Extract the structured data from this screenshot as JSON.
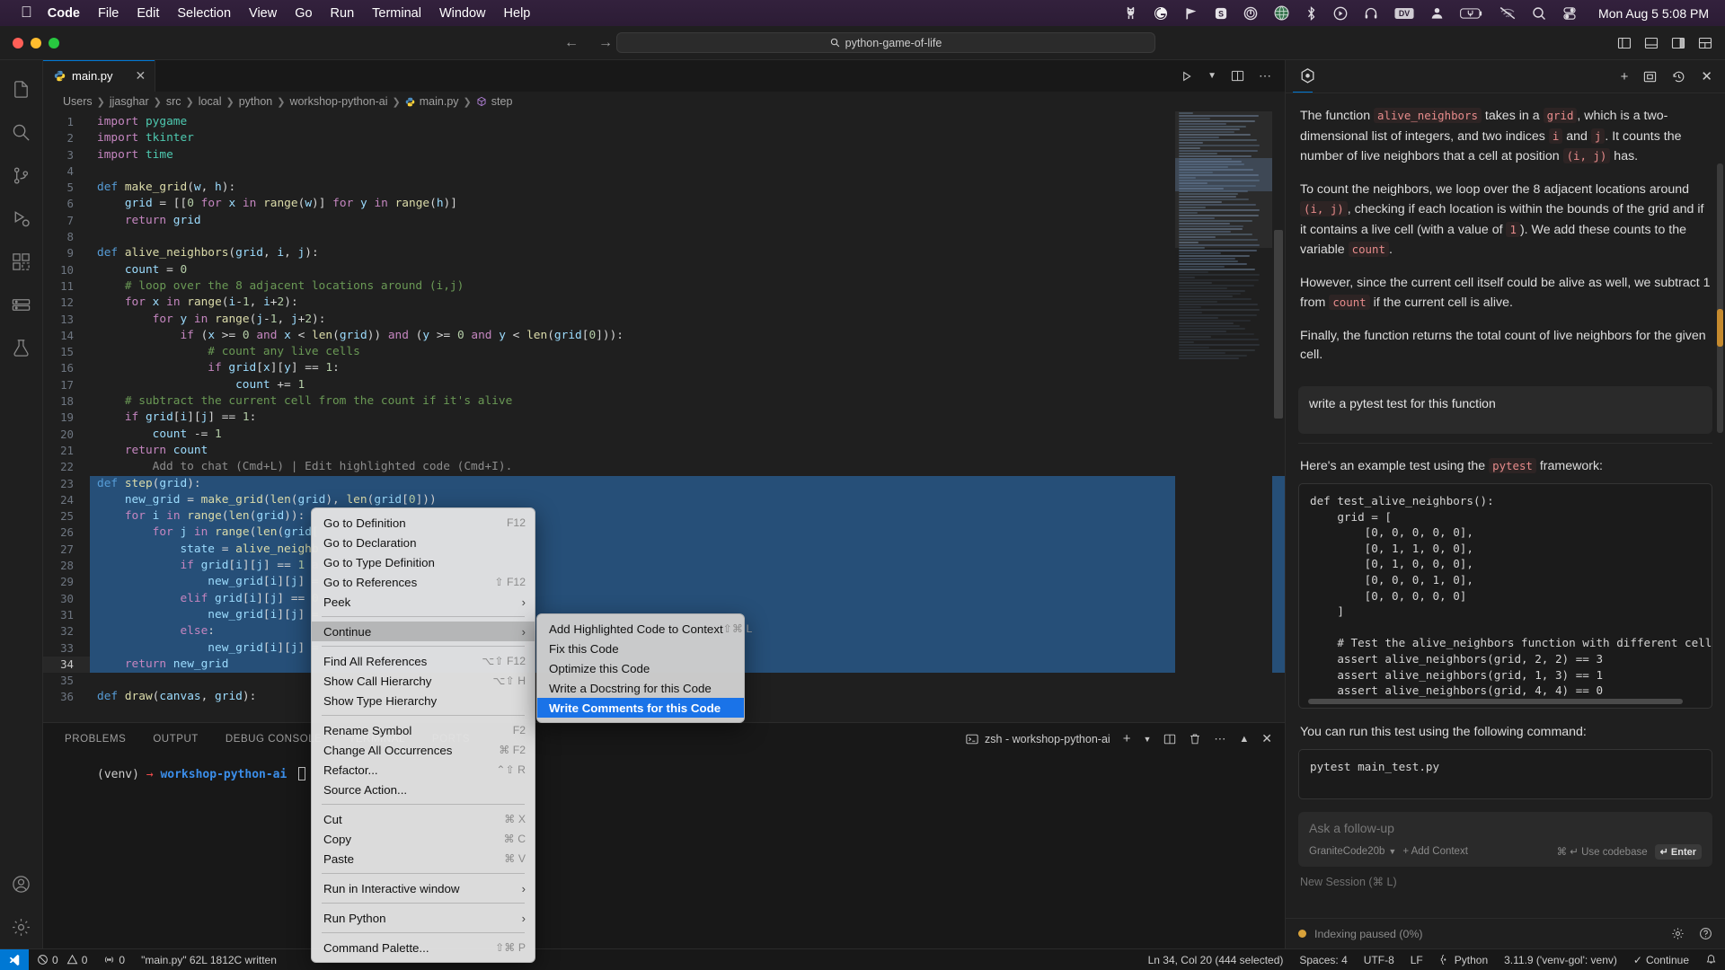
{
  "macos_menubar": {
    "apple_icon": "apple-icon",
    "items": [
      "Code",
      "File",
      "Edit",
      "Selection",
      "View",
      "Go",
      "Run",
      "Terminal",
      "Window",
      "Help"
    ],
    "tray_icons": [
      "llama-icon",
      "grammarly-icon",
      "flag-icon",
      "s-badge-icon",
      "onepassword-icon",
      "globe-icon",
      "bluetooth-icon",
      "play-circle-icon",
      "headphones-icon",
      "dv-icon",
      "person-icon",
      "battery-icon",
      "wifi-off-icon",
      "search-icon",
      "control-center-icon"
    ],
    "clock": "Mon Aug 5  5:08 PM"
  },
  "titlebar": {
    "search_value": "python-game-of-life",
    "search_icon": "search-icon",
    "back_icon": "arrow-left-icon",
    "forward_icon": "arrow-right-icon",
    "layout_icons": [
      "toggle-primary-sidebar-icon",
      "toggle-panel-icon",
      "toggle-secondary-sidebar-icon",
      "customize-layout-icon"
    ]
  },
  "activitybar": {
    "items": [
      {
        "name": "explorer",
        "icon": "files-icon"
      },
      {
        "name": "search",
        "icon": "search-icon"
      },
      {
        "name": "source-control",
        "icon": "source-control-icon"
      },
      {
        "name": "run-and-debug",
        "icon": "debug-icon"
      },
      {
        "name": "extensions",
        "icon": "extensions-icon"
      },
      {
        "name": "remote-explorer",
        "icon": "remote-explorer-icon"
      },
      {
        "name": "testing",
        "icon": "beaker-icon"
      }
    ],
    "bottom": [
      {
        "name": "accounts",
        "icon": "account-icon"
      },
      {
        "name": "settings",
        "icon": "gear-icon"
      }
    ]
  },
  "editor": {
    "tab": {
      "label": "main.py",
      "icon": "python-file-icon",
      "close_icon": "close-icon"
    },
    "tab_actions": [
      "run-python-icon",
      "chevron-down-icon",
      "split-editor-icon",
      "more-actions-icon"
    ],
    "breadcrumb": [
      "Users",
      "jjasghar",
      "src",
      "local",
      "python",
      "workshop-python-ai",
      "main.py",
      "step"
    ],
    "lines": [
      {
        "n": 1,
        "html": "<span class='k'>import</span> <span class='bu'>pygame</span>"
      },
      {
        "n": 2,
        "html": "<span class='k'>import</span> <span class='bu'>tkinter</span>"
      },
      {
        "n": 3,
        "html": "<span class='k'>import</span> <span class='bu'>time</span>"
      },
      {
        "n": 4,
        "html": ""
      },
      {
        "n": 5,
        "html": "<span class='kb'>def</span> <span class='fn'>make_grid</span><span class='pl'>(</span><span class='va'>w</span><span class='pl'>, </span><span class='va'>h</span><span class='pl'>):</span>"
      },
      {
        "n": 6,
        "html": "    <span class='va'>grid</span> <span class='pl'>= [[</span><span class='nu'>0</span> <span class='k'>for</span> <span class='va'>x</span> <span class='k'>in</span> <span class='fn'>range</span><span class='pl'>(</span><span class='va'>w</span><span class='pl'>)] </span><span class='k'>for</span> <span class='va'>y</span> <span class='k'>in</span> <span class='fn'>range</span><span class='pl'>(</span><span class='va'>h</span><span class='pl'>)]</span>"
      },
      {
        "n": 7,
        "html": "    <span class='k'>return</span> <span class='va'>grid</span>"
      },
      {
        "n": 8,
        "html": ""
      },
      {
        "n": 9,
        "html": "<span class='kb'>def</span> <span class='fn'>alive_neighbors</span><span class='pl'>(</span><span class='va'>grid</span><span class='pl'>, </span><span class='va'>i</span><span class='pl'>, </span><span class='va'>j</span><span class='pl'>):</span>"
      },
      {
        "n": 10,
        "html": "    <span class='va'>count</span> <span class='pl'>= </span><span class='nu'>0</span>"
      },
      {
        "n": 11,
        "html": "    <span class='cm'># loop over the 8 adjacent locations around (i,j)</span>"
      },
      {
        "n": 12,
        "html": "    <span class='k'>for</span> <span class='va'>x</span> <span class='k'>in</span> <span class='fn'>range</span><span class='pl'>(</span><span class='va'>i</span><span class='pl'>-</span><span class='nu'>1</span><span class='pl'>, </span><span class='va'>i</span><span class='pl'>+</span><span class='nu'>2</span><span class='pl'>):</span>"
      },
      {
        "n": 13,
        "html": "        <span class='k'>for</span> <span class='va'>y</span> <span class='k'>in</span> <span class='fn'>range</span><span class='pl'>(</span><span class='va'>j</span><span class='pl'>-</span><span class='nu'>1</span><span class='pl'>, </span><span class='va'>j</span><span class='pl'>+</span><span class='nu'>2</span><span class='pl'>):</span>"
      },
      {
        "n": 14,
        "html": "            <span class='k'>if</span> <span class='pl'>(</span><span class='va'>x</span> <span class='pl'>&gt;= </span><span class='nu'>0</span> <span class='k'>and</span> <span class='va'>x</span> <span class='pl'>&lt; </span><span class='fn'>len</span><span class='pl'>(</span><span class='va'>grid</span><span class='pl'>)) </span><span class='k'>and</span> <span class='pl'>(</span><span class='va'>y</span> <span class='pl'>&gt;= </span><span class='nu'>0</span> <span class='k'>and</span> <span class='va'>y</span> <span class='pl'>&lt; </span><span class='fn'>len</span><span class='pl'>(</span><span class='va'>grid</span><span class='pl'>[</span><span class='nu'>0</span><span class='pl'>])):</span>"
      },
      {
        "n": 15,
        "html": "                <span class='cm'># count any live cells</span>"
      },
      {
        "n": 16,
        "html": "                <span class='k'>if</span> <span class='va'>grid</span><span class='pl'>[</span><span class='va'>x</span><span class='pl'>][</span><span class='va'>y</span><span class='pl'>] == </span><span class='nu'>1</span><span class='pl'>:</span>"
      },
      {
        "n": 17,
        "html": "                    <span class='va'>count</span> <span class='pl'>+= </span><span class='nu'>1</span>"
      },
      {
        "n": 18,
        "html": "    <span class='cm'># subtract the current cell from the count if it's alive</span>"
      },
      {
        "n": 19,
        "html": "    <span class='k'>if</span> <span class='va'>grid</span><span class='pl'>[</span><span class='va'>i</span><span class='pl'>][</span><span class='va'>j</span><span class='pl'>] == </span><span class='nu'>1</span><span class='pl'>:</span>"
      },
      {
        "n": 20,
        "html": "        <span class='va'>count</span> <span class='pl'>-= </span><span class='nu'>1</span>"
      },
      {
        "n": 21,
        "html": "    <span class='k'>return</span> <span class='va'>count</span>"
      },
      {
        "n": 22,
        "html": "        <span class='ghost'>Add to chat (Cmd+L) | Edit highlighted code (Cmd+I).</span>"
      },
      {
        "n": 23,
        "html": "<span class='kb'>def</span> <span class='fn'>step</span><span class='pl'>(</span><span class='va'>grid</span><span class='pl'>):</span>",
        "sel": true
      },
      {
        "n": 24,
        "html": "    <span class='va'>new_grid</span> <span class='pl'>= </span><span class='fn'>make_grid</span><span class='pl'>(</span><span class='fn'>len</span><span class='pl'>(</span><span class='va'>grid</span><span class='pl'>), </span><span class='fn'>len</span><span class='pl'>(</span><span class='va'>grid</span><span class='pl'>[</span><span class='nu'>0</span><span class='pl'>]))</span>",
        "sel": true
      },
      {
        "n": 25,
        "html": "    <span class='k'>for</span> <span class='va'>i</span> <span class='k'>in</span> <span class='fn'>range</span><span class='pl'>(</span><span class='fn'>len</span><span class='pl'>(</span><span class='va'>grid</span><span class='pl'>)):</span>",
        "sel": true
      },
      {
        "n": 26,
        "html": "        <span class='k'>for</span> <span class='va'>j</span> <span class='k'>in</span> <span class='fn'>range</span><span class='pl'>(</span><span class='fn'>len</span><span class='pl'>(</span><span class='va'>grid</span><span class='pl'>[</span>",
        "sel": true
      },
      {
        "n": 27,
        "html": "            <span class='va'>state</span> <span class='pl'>= </span><span class='fn'>alive_neighb</span>",
        "sel": true
      },
      {
        "n": 28,
        "html": "            <span class='k'>if</span> <span class='va'>grid</span><span class='pl'>[</span><span class='va'>i</span><span class='pl'>][</span><span class='va'>j</span><span class='pl'>] == </span><span class='nu'>1</span> <span class='k'>a</span>",
        "sel": true
      },
      {
        "n": 29,
        "html": "                <span class='va'>new_grid</span><span class='pl'>[</span><span class='va'>i</span><span class='pl'>][</span><span class='va'>j</span><span class='pl'>] =</span>",
        "sel": true
      },
      {
        "n": 30,
        "html": "            <span class='k'>elif</span> <span class='va'>grid</span><span class='pl'>[</span><span class='va'>i</span><span class='pl'>][</span><span class='va'>j</span><span class='pl'>] ==</span> <span class='nu'>0</span>",
        "sel": true
      },
      {
        "n": 31,
        "html": "                <span class='va'>new_grid</span><span class='pl'>[</span><span class='va'>i</span><span class='pl'>][</span><span class='va'>j</span><span class='pl'>] =</span>",
        "sel": true
      },
      {
        "n": 32,
        "html": "            <span class='k'>else</span><span class='pl'>:</span>",
        "sel": true
      },
      {
        "n": 33,
        "html": "                <span class='va'>new_grid</span><span class='pl'>[</span><span class='va'>i</span><span class='pl'>][</span><span class='va'>j</span><span class='pl'>] =</span>",
        "sel": true
      },
      {
        "n": 34,
        "html": "    <span class='k'>return</span> <span class='va'>new_grid</span>",
        "sel": true,
        "cursor": true
      },
      {
        "n": 35,
        "html": ""
      },
      {
        "n": 36,
        "html": "<span class='kb'>def</span> <span class='fn'>draw</span><span class='pl'>(</span><span class='va'>canvas</span><span class='pl'>, </span><span class='va'>grid</span><span class='pl'>):</span>"
      }
    ]
  },
  "panel": {
    "tabs": [
      "PROBLEMS",
      "OUTPUT",
      "DEBUG CONSOLE",
      "TERMINAL",
      "PORTS"
    ],
    "active_tab": "TERMINAL",
    "terminal_name": "zsh - workshop-python-ai",
    "terminal_icon": "terminal-icon",
    "actions": [
      "add-terminal-icon",
      "chevron-down-icon",
      "split-terminal-icon",
      "kill-terminal-icon",
      "more-actions-icon",
      "maximize-panel-icon",
      "close-panel-icon"
    ],
    "prompt": {
      "venv": "(venv)",
      "arrow": "→",
      "dir": "workshop-python-ai"
    }
  },
  "chat": {
    "logo_icon": "continue-logo-icon",
    "header_actions": [
      "new-session-icon",
      "expand-icon",
      "history-icon",
      "close-icon"
    ],
    "assistant_paragraphs": [
      {
        "parts": [
          {
            "t": "text",
            "v": "The function "
          },
          {
            "t": "code",
            "v": "alive_neighbors"
          },
          {
            "t": "text",
            "v": " takes in a "
          },
          {
            "t": "code",
            "v": "grid"
          },
          {
            "t": "text",
            "v": ", which is a two-dimensional list of integers, and two indices "
          },
          {
            "t": "code",
            "v": "i"
          },
          {
            "t": "text",
            "v": " and "
          },
          {
            "t": "code",
            "v": "j"
          },
          {
            "t": "text",
            "v": ". It counts the number of live neighbors that a cell at position "
          },
          {
            "t": "code",
            "v": "(i, j)"
          },
          {
            "t": "text",
            "v": " has."
          }
        ]
      },
      {
        "parts": [
          {
            "t": "text",
            "v": "To count the neighbors, we loop over the 8 adjacent locations around "
          },
          {
            "t": "code",
            "v": "(i, j)"
          },
          {
            "t": "text",
            "v": ", checking if each location is within the bounds of the grid and if it contains a live cell (with a value of "
          },
          {
            "t": "code",
            "v": "1"
          },
          {
            "t": "text",
            "v": "). We add these counts to the variable "
          },
          {
            "t": "code",
            "v": "count"
          },
          {
            "t": "text",
            "v": "."
          }
        ]
      },
      {
        "parts": [
          {
            "t": "text",
            "v": "However, since the current cell itself could be alive as well, we subtract 1 from "
          },
          {
            "t": "code",
            "v": "count"
          },
          {
            "t": "text",
            "v": " if the current cell is alive."
          }
        ]
      },
      {
        "parts": [
          {
            "t": "text",
            "v": "Finally, the function returns the total count of live neighbors for the given cell."
          }
        ]
      }
    ],
    "user_message": "write a pytest test for this function",
    "reply_intro": {
      "parts": [
        {
          "t": "text",
          "v": "Here's an example test using the "
        },
        {
          "t": "code",
          "v": "pytest"
        },
        {
          "t": "text",
          "v": " framework:"
        }
      ]
    },
    "code_block": "def test_alive_neighbors():\n    grid = [\n        [0, 0, 0, 0, 0],\n        [0, 1, 1, 0, 0],\n        [0, 1, 0, 0, 0],\n        [0, 0, 0, 1, 0],\n        [0, 0, 0, 0, 0]\n    ]\n\n    # Test the alive_neighbors function with different cell pos\n    assert alive_neighbors(grid, 2, 2) == 3\n    assert alive_neighbors(grid, 1, 3) == 1\n    assert alive_neighbors(grid, 4, 4) == 0",
    "run_intro": "You can run this test using the following command:",
    "run_command": "pytest main_test.py",
    "ask_placeholder": "Ask a follow-up",
    "model_name": "GraniteCode20b",
    "add_context": "+ Add Context",
    "use_codebase": "⌘ ↵ Use codebase",
    "enter_label": "↵ Enter",
    "new_session": "New Session (⌘ L)",
    "indexing_status": "Indexing paused (0%)",
    "status_icons": [
      "gear-icon",
      "help-icon"
    ]
  },
  "context_menu": {
    "groups": [
      [
        {
          "label": "Go to Definition",
          "kbd": "F12"
        },
        {
          "label": "Go to Declaration",
          "kbd": ""
        },
        {
          "label": "Go to Type Definition",
          "kbd": ""
        },
        {
          "label": "Go to References",
          "kbd": "⇧ F12"
        },
        {
          "label": "Peek",
          "submenu": true
        }
      ],
      [
        {
          "label": "Continue",
          "submenu": true,
          "highlighted": true
        }
      ],
      [
        {
          "label": "Find All References",
          "kbd": "⌥⇧ F12"
        },
        {
          "label": "Show Call Hierarchy",
          "kbd": "⌥⇧ H"
        },
        {
          "label": "Show Type Hierarchy",
          "kbd": ""
        }
      ],
      [
        {
          "label": "Rename Symbol",
          "kbd": "F2"
        },
        {
          "label": "Change All Occurrences",
          "kbd": "⌘ F2"
        },
        {
          "label": "Refactor...",
          "kbd": "⌃⇧ R"
        },
        {
          "label": "Source Action...",
          "kbd": ""
        }
      ],
      [
        {
          "label": "Cut",
          "kbd": "⌘ X"
        },
        {
          "label": "Copy",
          "kbd": "⌘ C"
        },
        {
          "label": "Paste",
          "kbd": "⌘ V"
        }
      ],
      [
        {
          "label": "Run in Interactive window",
          "submenu": true
        }
      ],
      [
        {
          "label": "Run Python",
          "submenu": true
        }
      ],
      [
        {
          "label": "Command Palette...",
          "kbd": "⇧⌘ P"
        }
      ]
    ]
  },
  "submenu": {
    "items": [
      {
        "label": "Add Highlighted Code to Context",
        "kbd": "⇧⌘ L",
        "selected": false
      },
      {
        "label": "Fix this Code",
        "kbd": "",
        "selected": false
      },
      {
        "label": "Optimize this Code",
        "kbd": "",
        "selected": false
      },
      {
        "label": "Write a Docstring for this Code",
        "kbd": "",
        "selected": false
      },
      {
        "label": "Write Comments for this Code",
        "kbd": "",
        "selected": true
      }
    ]
  },
  "statusbar": {
    "remote_icon": "remote-window-icon",
    "errors": "0",
    "warnings": "0",
    "radio_tower": "0",
    "file_status": "\"main.py\" 62L 1812C written",
    "cursor_position": "Ln 34, Col 20 (444 selected)",
    "spaces": "Spaces: 4",
    "encoding": "UTF-8",
    "eol": "LF",
    "language": "Python",
    "interpreter": "3.11.9 ('venv-gol': venv)",
    "continue_label": "Continue",
    "bell_icon": "bell-icon"
  }
}
